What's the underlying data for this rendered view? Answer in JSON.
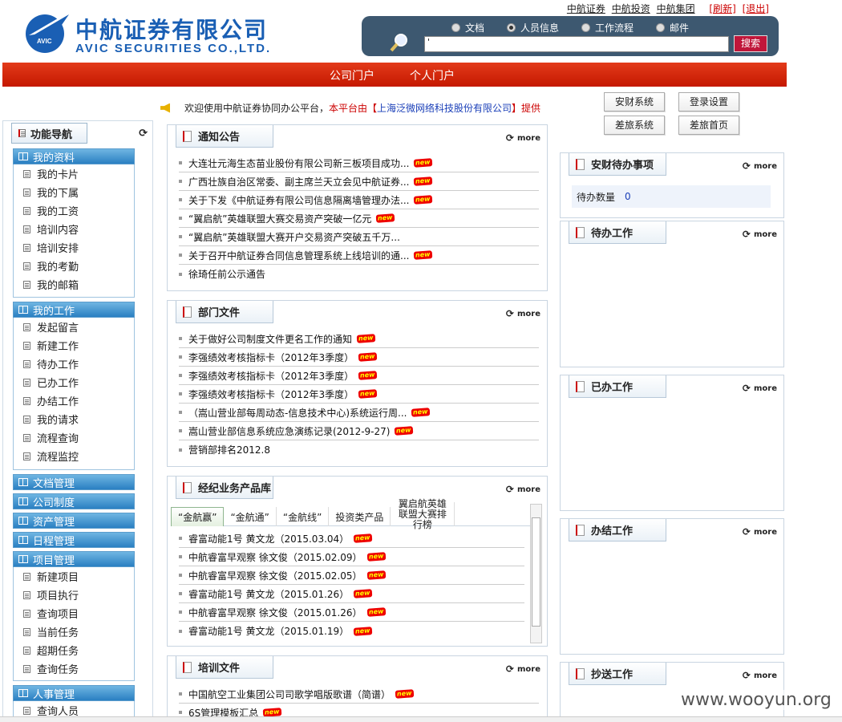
{
  "header": {
    "logo_cn": "中航证券有限公司",
    "logo_en": "AVIC SECURITIES CO.,LTD.",
    "logo_mark_text": "AVIC",
    "top_links": [
      "中航证券",
      "中航投资",
      "中航集团"
    ],
    "refresh_label": "[刷新]",
    "logout_label": "[退出]",
    "search_options": [
      "文档",
      "人员信息",
      "工作流程",
      "邮件"
    ],
    "search_selected": "人员信息",
    "search_value": "'",
    "search_button": "搜索"
  },
  "navbar": {
    "items": [
      "公司门户",
      "个人门户"
    ]
  },
  "welcome": {
    "prefix": "欢迎使用中航证券协同办公平台，",
    "middle": "本平台由【",
    "company": "上海泛微网络科技股份有限公司",
    "suffix": "】提供"
  },
  "sidebar": {
    "title": "功能导航",
    "refresh_icon": "⟳",
    "groups": [
      {
        "label": "我的资料",
        "items": [
          "我的卡片",
          "我的下属",
          "我的工资",
          "培训内容",
          "培训安排",
          "我的考勤",
          "我的邮箱"
        ]
      },
      {
        "label": "我的工作",
        "items": [
          "发起留言",
          "新建工作",
          "待办工作",
          "已办工作",
          "办结工作",
          "我的请求",
          "流程查询",
          "流程监控"
        ]
      },
      {
        "label": "文档管理",
        "items": []
      },
      {
        "label": "公司制度",
        "items": []
      },
      {
        "label": "资产管理",
        "items": []
      },
      {
        "label": "日程管理",
        "items": []
      },
      {
        "label": "项目管理",
        "items": [
          "新建项目",
          "项目执行",
          "查询项目",
          "当前任务",
          "超期任务",
          "查询任务"
        ]
      },
      {
        "label": "人事管理",
        "items": [
          "查询人员"
        ]
      }
    ]
  },
  "more_label": "more",
  "new_badge": "new",
  "panels": {
    "notice": {
      "title": "通知公告",
      "items": [
        {
          "text": "大连壮元海生态苗业股份有限公司新三板项目成功...",
          "new": true
        },
        {
          "text": "广西壮族自治区常委、副主席兰天立会见中航证券...",
          "new": true
        },
        {
          "text": "关于下发《中航证券有限公司信息隔离墙管理办法...",
          "new": true
        },
        {
          "text": "“翼启航”英雄联盟大赛交易资产突破一亿元",
          "new": true
        },
        {
          "text": "“翼启航”英雄联盟大赛开户交易资产突破五千万...",
          "new": false
        },
        {
          "text": "关于召开中航证券合同信息管理系统上线培训的通...",
          "new": true
        },
        {
          "text": "徐琦任前公示通告",
          "new": false
        }
      ]
    },
    "dept": {
      "title": "部门文件",
      "items": [
        {
          "text": "关于做好公司制度文件更名工作的通知",
          "new": true
        },
        {
          "text": "李强绩效考核指标卡（2012年3季度）",
          "new": true
        },
        {
          "text": "李强绩效考核指标卡（2012年3季度）",
          "new": true
        },
        {
          "text": "李强绩效考核指标卡（2012年3季度）",
          "new": true
        },
        {
          "text": "（嵩山营业部每周动态-信息技术中心)系统运行周...",
          "new": true
        },
        {
          "text": "嵩山营业部信息系统应急演练记录(2012-9-27)",
          "new": true
        },
        {
          "text": "营销部排名2012.8",
          "new": false
        }
      ]
    },
    "products": {
      "title": "经纪业务产品库",
      "tabs": [
        "“金航赢”",
        "“金航通”",
        "“金航线”",
        "投资类产品",
        "翼启航英雄联盟大赛排行榜"
      ],
      "items": [
        {
          "text": "睿富动能1号 黄文龙（2015.03.04）",
          "new": true
        },
        {
          "text": "中航睿富早观察 徐文俊（2015.02.09）",
          "new": true
        },
        {
          "text": "中航睿富早观察 徐文俊（2015.02.05）",
          "new": true
        },
        {
          "text": "睿富动能1号 黄文龙（2015.01.26）",
          "new": true
        },
        {
          "text": "中航睿富早观察 徐文俊（2015.01.26）",
          "new": true
        },
        {
          "text": "睿富动能1号 黄文龙（2015.01.19）",
          "new": true
        }
      ]
    },
    "training": {
      "title": "培训文件",
      "items": [
        {
          "text": "中国航空工业集团公司司歌学唱版歌谱（简谱）",
          "new": true
        },
        {
          "text": "6S管理模板汇总",
          "new": true
        }
      ]
    },
    "anchai": {
      "title": "安财待办事项",
      "pending_label": "待办数量",
      "pending_count": "0"
    },
    "todo": {
      "title": "待办工作"
    },
    "done": {
      "title": "已办工作"
    },
    "finished": {
      "title": "办结工作"
    },
    "cc": {
      "title": "抄送工作"
    }
  },
  "buttons": [
    "安财系统",
    "登录设置",
    "差旅系统",
    "差旅首页"
  ],
  "watermark": "www.wooyun.org",
  "colors": {
    "brand_blue": "#1a5fb4",
    "nav_red": "#d42a0e",
    "search_bg": "#3d5870"
  }
}
